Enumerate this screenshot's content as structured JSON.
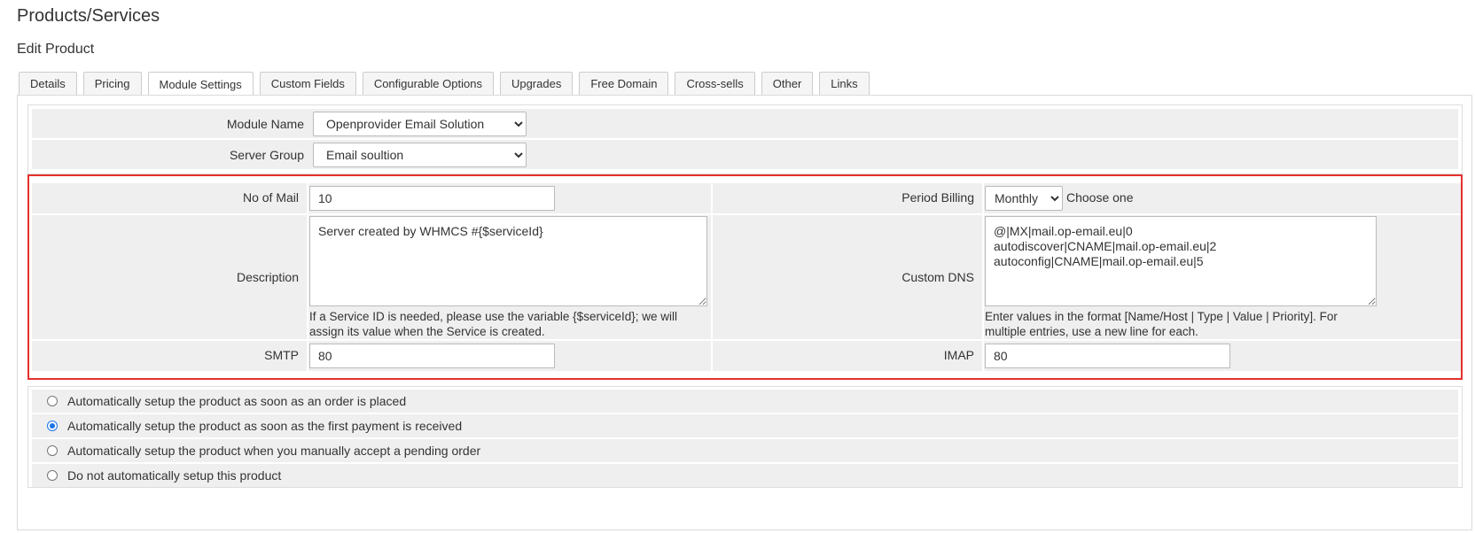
{
  "page": {
    "title": "Products/Services",
    "subtitle": "Edit Product"
  },
  "tabs": [
    {
      "label": "Details"
    },
    {
      "label": "Pricing"
    },
    {
      "label": "Module Settings"
    },
    {
      "label": "Custom Fields"
    },
    {
      "label": "Configurable Options"
    },
    {
      "label": "Upgrades"
    },
    {
      "label": "Free Domain"
    },
    {
      "label": "Cross-sells"
    },
    {
      "label": "Other"
    },
    {
      "label": "Links"
    }
  ],
  "module": {
    "module_name_label": "Module Name",
    "module_name_value": "Openprovider Email Solution",
    "server_group_label": "Server Group",
    "server_group_value": "Email soultion"
  },
  "settings": {
    "no_of_mail_label": "No of Mail",
    "no_of_mail_value": "10",
    "description_label": "Description",
    "description_value": "Server created by WHMCS #{$serviceId}",
    "description_help": "If a Service ID is needed, please use the variable {$serviceId}; we will assign its value when the Service is created.",
    "smtp_label": "SMTP",
    "smtp_value": "80",
    "period_billing_label": "Period Billing",
    "period_billing_value": "Monthly",
    "period_billing_hint": "Choose one",
    "custom_dns_label": "Custom DNS",
    "custom_dns_value": "@|MX|mail.op-email.eu|0\nautodiscover|CNAME|mail.op-email.eu|2\nautoconfig|CNAME|mail.op-email.eu|5",
    "custom_dns_help": "Enter values in the format [Name/Host | Type | Value | Priority]. For multiple entries, use a new line for each.",
    "imap_label": "IMAP",
    "imap_value": "80"
  },
  "setup_options": [
    {
      "label": "Automatically setup the product as soon as an order is placed",
      "checked": false
    },
    {
      "label": "Automatically setup the product as soon as the first payment is received",
      "checked": true
    },
    {
      "label": "Automatically setup the product when you manually accept a pending order",
      "checked": false
    },
    {
      "label": "Do not automatically setup this product",
      "checked": false
    }
  ],
  "colors": {
    "highlight_border": "#e3312d",
    "row_bg": "#efefef",
    "radio_accent": "#1a73e8"
  }
}
